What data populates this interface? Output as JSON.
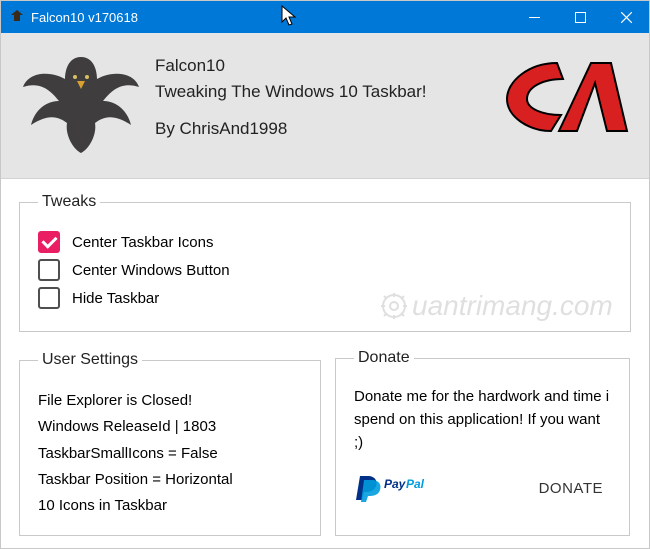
{
  "titlebar": {
    "title": "Falcon10 v170618"
  },
  "header": {
    "appname": "Falcon10",
    "tagline": "Tweaking The Windows 10 Taskbar!",
    "byline": "By ChrisAnd1998"
  },
  "tweaks": {
    "legend": "Tweaks",
    "items": [
      {
        "label": "Center Taskbar Icons",
        "checked": true
      },
      {
        "label": "Center Windows Button",
        "checked": false
      },
      {
        "label": "Hide Taskbar",
        "checked": false
      }
    ]
  },
  "user_settings": {
    "legend": "User Settings",
    "lines": [
      "File Explorer is Closed!",
      "Windows ReleaseId | 1803",
      "TaskbarSmallIcons = False",
      "Taskbar Position = Horizontal",
      "10 Icons in Taskbar"
    ]
  },
  "donate": {
    "legend": "Donate",
    "text": "Donate me for the hardwork and time i spend on this application! If you want ;)",
    "button": "DONATE"
  },
  "watermark": "uantrimang.com"
}
